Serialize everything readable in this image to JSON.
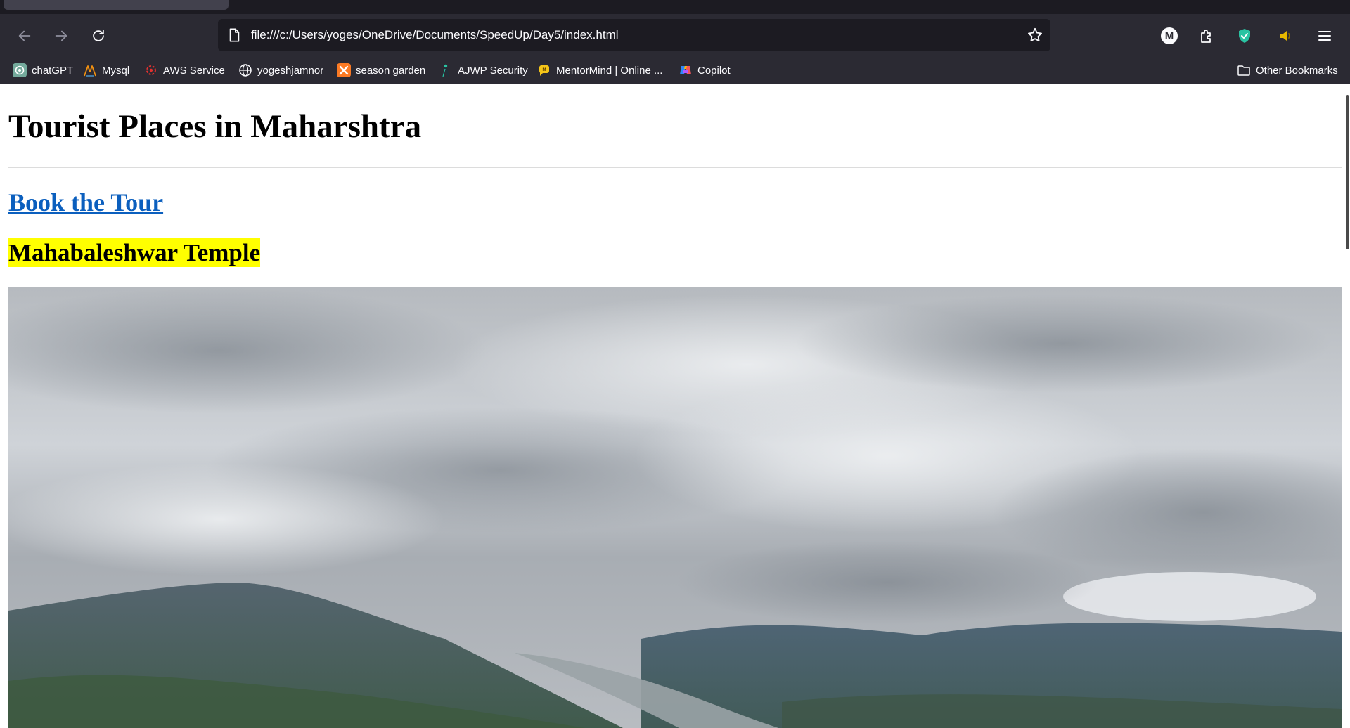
{
  "browser": {
    "address_bar": {
      "url": "file:///c:/Users/yoges/OneDrive/Documents/SpeedUp/Day5/index.html"
    },
    "account_initial": "M",
    "bookmarks": [
      {
        "label": "chatGPT",
        "icon": "chatgpt-icon"
      },
      {
        "label": "Mysql",
        "icon": "mysql-icon"
      },
      {
        "label": "AWS Service",
        "icon": "aws-icon"
      },
      {
        "label": "yogeshjamnor",
        "icon": "globe-icon"
      },
      {
        "label": "season garden",
        "icon": "xampp-icon"
      },
      {
        "label": "AJWP Security",
        "icon": "security-icon"
      },
      {
        "label": "MentorMind | Online ...",
        "icon": "mentormind-icon"
      },
      {
        "label": "Copilot",
        "icon": "copilot-icon"
      }
    ],
    "other_bookmarks": "Other Bookmarks",
    "colors": {
      "chrome_dark": "#2b2a33",
      "tabstrip": "#1c1b22",
      "shield_green": "#2ac3a2",
      "speaker_yellow": "#e6b800"
    }
  },
  "page": {
    "title": "Tourist Places in Maharshtra",
    "book_link": "Book the Tour",
    "place_heading": "Mahabaleshwar Temple",
    "colors": {
      "link": "#0b5fbe",
      "highlight": "#ffff00"
    }
  }
}
